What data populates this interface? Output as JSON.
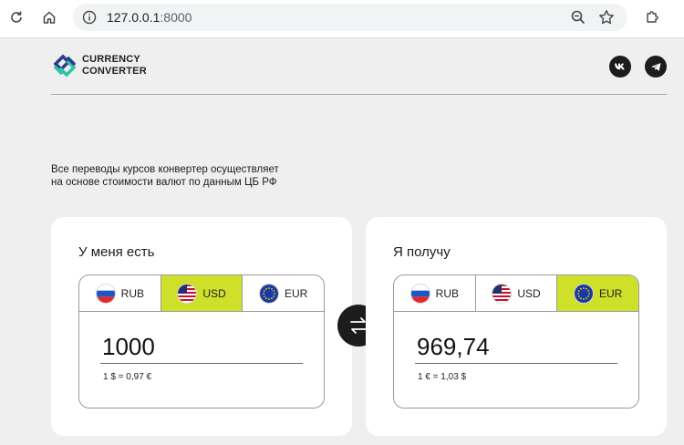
{
  "browser": {
    "url_host": "127.0.0.1",
    "url_port": ":8000"
  },
  "logo": {
    "line1": "CURRENCY",
    "line2": "CONVERTER"
  },
  "intro": {
    "line1": "Все переводы курсов конвертер осуществляет",
    "line2": "на основе стоимости валют по данным ЦБ РФ"
  },
  "from_card": {
    "title": "У меня есть",
    "tabs": [
      {
        "label": "RUB",
        "active": false
      },
      {
        "label": "USD",
        "active": true
      },
      {
        "label": "EUR",
        "active": false
      }
    ],
    "amount": "1000",
    "rate": "1 $ = 0,97 €"
  },
  "to_card": {
    "title": "Я получу",
    "tabs": [
      {
        "label": "RUB",
        "active": false
      },
      {
        "label": "USD",
        "active": false
      },
      {
        "label": "EUR",
        "active": true
      }
    ],
    "amount": "969,74",
    "rate": "1 € = 1,03 $"
  },
  "colors": {
    "accent": "#cfe02a",
    "background": "#efefef",
    "card": "#ffffff",
    "dark": "#1c1c1c"
  },
  "icons": {
    "reload": "reload-icon",
    "home": "home-icon",
    "site_info": "site-info-icon",
    "zoom": "zoom-icon",
    "bookmark": "star-icon",
    "extensions": "puzzle-icon",
    "vk": "vk-icon",
    "telegram": "telegram-icon",
    "swap": "swap-arrows-icon"
  }
}
